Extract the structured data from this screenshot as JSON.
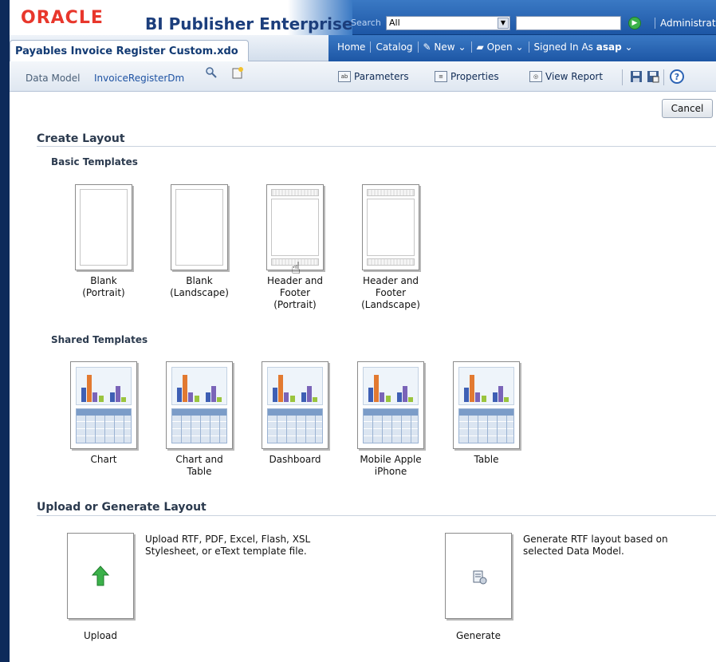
{
  "header": {
    "logo": "ORACLE",
    "product": "BI Publisher Enterprise",
    "search_label": "Search",
    "search_scope": "All",
    "admin_link": "Administration"
  },
  "doc_bar": {
    "document_title": "Payables Invoice Register Custom.xdo",
    "home": "Home",
    "catalog": "Catalog",
    "new": "New",
    "open": "Open",
    "signed_in_as": "Signed In As",
    "user": "asap"
  },
  "toolbar": {
    "data_model_label": "Data Model",
    "data_model_name": "InvoiceRegisterDm",
    "parameters": "Parameters",
    "properties": "Properties",
    "view_report": "View Report"
  },
  "content": {
    "cancel": "Cancel",
    "create_layout": "Create Layout",
    "basic_templates": "Basic Templates",
    "shared_templates": "Shared Templates",
    "upload_generate": "Upload or Generate Layout",
    "basic": [
      {
        "line1": "Blank",
        "line2": "(Portrait)",
        "line3": ""
      },
      {
        "line1": "Blank",
        "line2": "(Landscape)",
        "line3": ""
      },
      {
        "line1": "Header and",
        "line2": "Footer",
        "line3": "(Portrait)"
      },
      {
        "line1": "Header and",
        "line2": "Footer",
        "line3": "(Landscape)"
      }
    ],
    "shared": [
      {
        "line1": "Chart",
        "line2": ""
      },
      {
        "line1": "Chart and",
        "line2": "Table"
      },
      {
        "line1": "Dashboard",
        "line2": ""
      },
      {
        "line1": "Mobile Apple",
        "line2": "iPhone"
      },
      {
        "line1": "Table",
        "line2": ""
      }
    ],
    "upload": {
      "label": "Upload",
      "desc1": "Upload RTF, PDF, Excel, Flash, XSL",
      "desc2": "Stylesheet, or eText template file."
    },
    "generate": {
      "label": "Generate",
      "desc1": "Generate RTF layout based on",
      "desc2": "selected Data Model."
    }
  },
  "colors": {
    "brand_red": "#e8372c",
    "header_blue": "#1d56a5",
    "upload_arrow": "#3bb14a"
  }
}
